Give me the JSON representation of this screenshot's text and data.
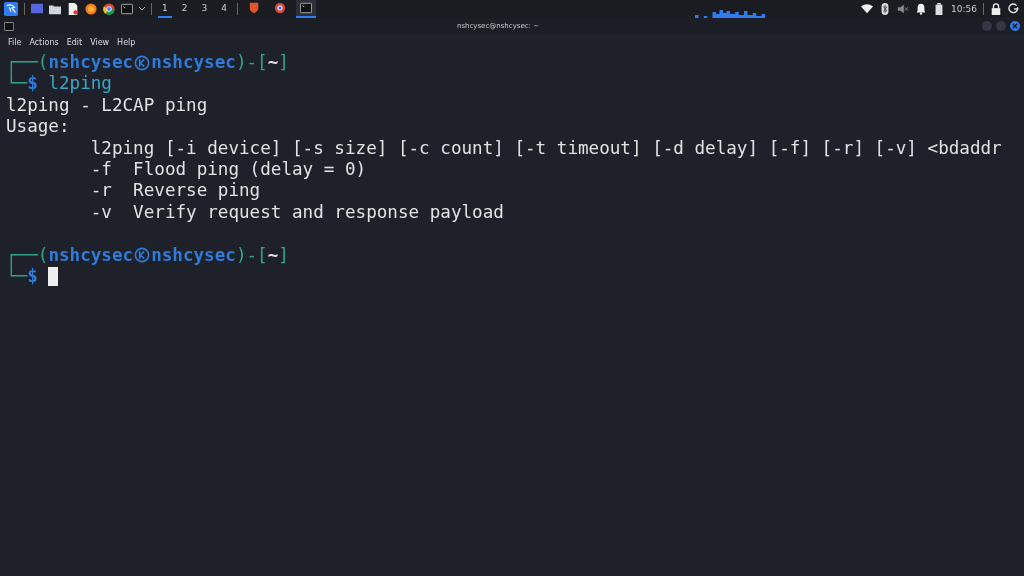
{
  "panel": {
    "workspaces": [
      {
        "label": "1",
        "selected": true
      },
      {
        "label": "2",
        "selected": false
      },
      {
        "label": "3",
        "selected": false
      },
      {
        "label": "4",
        "selected": false
      }
    ],
    "tasks": [
      {
        "kind": "browser-red",
        "selected": false
      },
      {
        "kind": "browser-round",
        "selected": false
      },
      {
        "kind": "terminal",
        "selected": true
      }
    ],
    "clock": "10:56"
  },
  "window": {
    "title": "nshcysec@nshcysec: ~",
    "menu": [
      "File",
      "Actions",
      "Edit",
      "View",
      "Help"
    ]
  },
  "terminal": {
    "lines": [
      {
        "kind": "prompt",
        "top": "┌──(",
        "user": "nshcysec",
        "host": "nshcysec",
        "mid": ")-[",
        "dir": "~",
        "close": "]",
        "corner": "└─",
        "dollar": "$",
        "command": "l2ping"
      },
      {
        "kind": "output",
        "text": "l2ping - L2CAP ping"
      },
      {
        "kind": "output",
        "text": "Usage:"
      },
      {
        "kind": "output",
        "text": "        l2ping [-i device] [-s size] [-c count] [-t timeout] [-d delay] [-f] [-r] [-v] <bdaddr"
      },
      {
        "kind": "output",
        "text": "        -f  Flood ping (delay = 0)"
      },
      {
        "kind": "output",
        "text": "        -r  Reverse ping"
      },
      {
        "kind": "output",
        "text": "        -v  Verify request and response payload"
      },
      {
        "kind": "blank"
      },
      {
        "kind": "prompt",
        "top": "┌──(",
        "user": "nshcysec",
        "host": "nshcysec",
        "mid": ")-[",
        "dir": "~",
        "close": "]",
        "corner": "└─",
        "dollar": "$",
        "cursor": true
      }
    ]
  }
}
